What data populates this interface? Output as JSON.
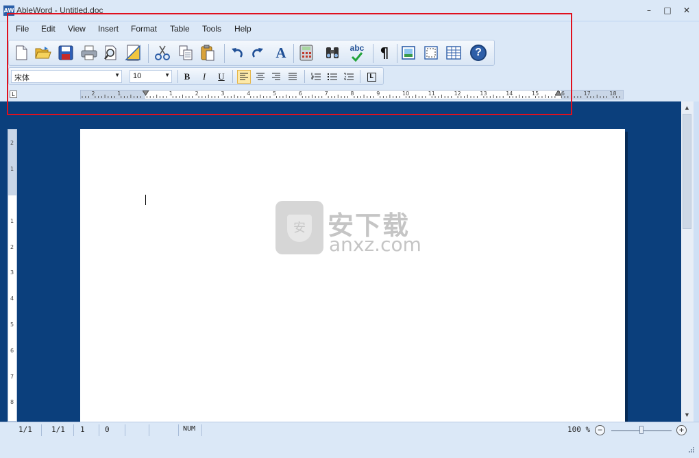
{
  "window": {
    "app_icon_text": "AW",
    "title": "AbleWord - Untitled.doc"
  },
  "title_buttons": {
    "minimize": "–",
    "maximize": "□",
    "close": "✕"
  },
  "menu": [
    "File",
    "Edit",
    "View",
    "Insert",
    "Format",
    "Table",
    "Tools",
    "Help"
  ],
  "toolbar": {
    "buttons": [
      "new-icon",
      "open-icon",
      "save-icon",
      "print-icon",
      "print-preview-icon",
      "page-setup-icon",
      "cut-icon",
      "copy-icon",
      "paste-icon",
      "undo-icon",
      "redo-icon",
      "font-icon",
      "calculator-icon",
      "find-icon",
      "spell-check-icon",
      "show-formatting-icon",
      "insert-image-icon",
      "insert-frame-icon",
      "insert-table-icon",
      "help-icon"
    ],
    "font_letter": "A",
    "spell_text": "abc",
    "pilcrow": "¶",
    "help_glyph": "?"
  },
  "format_toolbar": {
    "font_name": "宋体",
    "font_size": "10",
    "bold_label": "B",
    "italic_label": "I",
    "underline_label": "U"
  },
  "ruler": {
    "corner": "L",
    "numbers": [
      "2",
      "1",
      "1",
      "2",
      "3",
      "4",
      "5",
      "6",
      "7",
      "8",
      "9",
      "10",
      "11",
      "12",
      "13",
      "14",
      "15",
      "16",
      "17",
      "18"
    ]
  },
  "vruler_numbers": [
    "2",
    "1",
    "1",
    "2",
    "3",
    "4",
    "5",
    "6",
    "7",
    "8"
  ],
  "watermark": {
    "cn": "安下载",
    "en": "anxz.com",
    "shield_char": "安"
  },
  "status": {
    "page": "1/1",
    "section": "1/1",
    "line": "1",
    "column": "0",
    "num": "NUM",
    "zoom": "100 %",
    "zoom_minus": "−",
    "zoom_plus": "+"
  },
  "colors": {
    "highlight": "#e0101e",
    "workspace": "#0b3f7c",
    "chrome": "#dbe8f7"
  }
}
